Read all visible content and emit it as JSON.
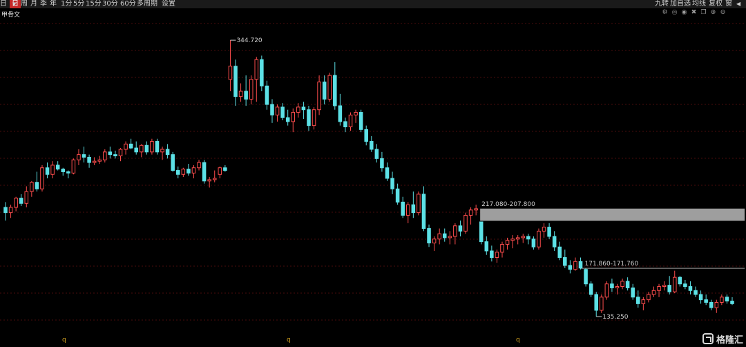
{
  "toolbar": {
    "left": [
      {
        "label": "日"
      },
      {
        "label": "日",
        "active": true
      },
      {
        "label": "周"
      },
      {
        "label": "月"
      },
      {
        "label": "季"
      },
      {
        "label": "年"
      },
      {
        "label": "1分"
      },
      {
        "label": "5分"
      },
      {
        "label": "15分"
      },
      {
        "label": "30分"
      },
      {
        "label": "60分"
      },
      {
        "label": "多周期"
      },
      {
        "label": "设置"
      }
    ],
    "right": [
      {
        "label": "九转"
      },
      {
        "label": "加自选"
      },
      {
        "label": "均线"
      },
      {
        "label": "复权"
      },
      {
        "label": "窗"
      }
    ]
  },
  "stock": {
    "name": "甲骨文"
  },
  "subbar_icons": [
    "settings-icon",
    "crosshair-icon",
    "eye-icon",
    "delete-icon",
    "copy-icon",
    "zoom-in-icon",
    "zoom-out-icon"
  ],
  "annotations": {
    "high": "344.720",
    "low": "135.250",
    "gap1": "217.080-207.800",
    "gap2": "171.860-171.760"
  },
  "x_axis_labels": [
    "q",
    "q",
    "q"
  ],
  "watermark": "格隆汇",
  "colors": {
    "up": "#ff4d4d",
    "down": "#5ce1e6",
    "grid": "#4a0d0d",
    "gap_box": "#9e9e9e",
    "background": "#000000"
  },
  "chart_data": {
    "type": "candlestick",
    "title": "",
    "note": "Each candle: [open, high, low, close]",
    "ohlc": [
      [
        218,
        222,
        208,
        214
      ],
      [
        214,
        220,
        210,
        218
      ],
      [
        218,
        226,
        215,
        225
      ],
      [
        225,
        228,
        219,
        221
      ],
      [
        221,
        234,
        218,
        230
      ],
      [
        230,
        238,
        226,
        237
      ],
      [
        237,
        245,
        230,
        232
      ],
      [
        232,
        250,
        230,
        248
      ],
      [
        248,
        252,
        240,
        243
      ],
      [
        243,
        253,
        240,
        250
      ],
      [
        250,
        253,
        246,
        247
      ],
      [
        247,
        248,
        242,
        245
      ],
      [
        245,
        246,
        240,
        244
      ],
      [
        244,
        255,
        243,
        254
      ],
      [
        254,
        262,
        250,
        258
      ],
      [
        258,
        264,
        252,
        256
      ],
      [
        256,
        258,
        248,
        252
      ],
      [
        252,
        256,
        250,
        253
      ],
      [
        253,
        257,
        251,
        254
      ],
      [
        254,
        262,
        252,
        260
      ],
      [
        260,
        264,
        255,
        258
      ],
      [
        258,
        261,
        255,
        257
      ],
      [
        257,
        263,
        253,
        262
      ],
      [
        262,
        268,
        258,
        266
      ],
      [
        266,
        270,
        262,
        263
      ],
      [
        263,
        268,
        258,
        260
      ],
      [
        260,
        266,
        256,
        265
      ],
      [
        265,
        268,
        258,
        260
      ],
      [
        260,
        270,
        258,
        268
      ],
      [
        268,
        270,
        258,
        260
      ],
      [
        260,
        264,
        254,
        262
      ],
      [
        262,
        266,
        255,
        258
      ],
      [
        258,
        260,
        245,
        246
      ],
      [
        246,
        249,
        240,
        243
      ],
      [
        243,
        248,
        241,
        247
      ],
      [
        247,
        251,
        242,
        244
      ],
      [
        244,
        250,
        240,
        248
      ],
      [
        248,
        254,
        246,
        252
      ],
      [
        252,
        254,
        236,
        238
      ],
      [
        238,
        241,
        233,
        239
      ],
      [
        239,
        246,
        237,
        240
      ],
      [
        243,
        249,
        240,
        248
      ],
      [
        248,
        250,
        245,
        246
      ],
      [
        315,
        344.7,
        306,
        325
      ],
      [
        325,
        330,
        295,
        302
      ],
      [
        302,
        312,
        298,
        306
      ],
      [
        306,
        318,
        295,
        300
      ],
      [
        300,
        318,
        296,
        315
      ],
      [
        315,
        332,
        298,
        330
      ],
      [
        330,
        333,
        306,
        310
      ],
      [
        310,
        314,
        292,
        296
      ],
      [
        296,
        300,
        282,
        288
      ],
      [
        288,
        296,
        283,
        294
      ],
      [
        294,
        297,
        284,
        286
      ],
      [
        286,
        292,
        280,
        283
      ],
      [
        283,
        293,
        275,
        290
      ],
      [
        290,
        297,
        286,
        294
      ],
      [
        294,
        298,
        285,
        292
      ],
      [
        292,
        295,
        276,
        280
      ],
      [
        280,
        294,
        277,
        292
      ],
      [
        292,
        318,
        288,
        313
      ],
      [
        313,
        318,
        296,
        300
      ],
      [
        300,
        320,
        298,
        318
      ],
      [
        318,
        328,
        292,
        295
      ],
      [
        295,
        304,
        280,
        283
      ],
      [
        283,
        286,
        275,
        279
      ],
      [
        279,
        290,
        276,
        288
      ],
      [
        288,
        292,
        282,
        290
      ],
      [
        290,
        292,
        275,
        277
      ],
      [
        277,
        280,
        265,
        268
      ],
      [
        268,
        272,
        260,
        262
      ],
      [
        262,
        266,
        252,
        255
      ],
      [
        255,
        260,
        245,
        248
      ],
      [
        248,
        252,
        238,
        240
      ],
      [
        240,
        245,
        228,
        232
      ],
      [
        232,
        236,
        220,
        222
      ],
      [
        222,
        226,
        210,
        212
      ],
      [
        212,
        222,
        206,
        220
      ],
      [
        220,
        230,
        210,
        214
      ],
      [
        214,
        230,
        212,
        228
      ],
      [
        228,
        234,
        200,
        202
      ],
      [
        202,
        205,
        188,
        191
      ],
      [
        191,
        196,
        185,
        194
      ],
      [
        194,
        202,
        190,
        198
      ],
      [
        198,
        202,
        192,
        195
      ],
      [
        195,
        200,
        190,
        196
      ],
      [
        196,
        206,
        190,
        204
      ],
      [
        204,
        208,
        196,
        200
      ],
      [
        200,
        214,
        198,
        212
      ],
      [
        212,
        218,
        205,
        216
      ],
      [
        216,
        220,
        212,
        217
      ],
      [
        207,
        207,
        190,
        192
      ],
      [
        192,
        196,
        182,
        185
      ],
      [
        185,
        189,
        177,
        180
      ],
      [
        180,
        186,
        176,
        184
      ],
      [
        184,
        192,
        180,
        190
      ],
      [
        190,
        195,
        186,
        193
      ],
      [
        193,
        197,
        187,
        194
      ],
      [
        194,
        197,
        190,
        195
      ],
      [
        195,
        198,
        191,
        196
      ],
      [
        196,
        198,
        190,
        194
      ],
      [
        194,
        196,
        186,
        188
      ],
      [
        188,
        202,
        186,
        200
      ],
      [
        200,
        206,
        195,
        203
      ],
      [
        203,
        206,
        194,
        196
      ],
      [
        196,
        200,
        185,
        188
      ],
      [
        188,
        192,
        178,
        180
      ],
      [
        180,
        186,
        172,
        174
      ],
      [
        174,
        178,
        168,
        171
      ],
      [
        171,
        180,
        170,
        177
      ],
      [
        177,
        180,
        171,
        172
      ],
      [
        171,
        172,
        158,
        160
      ],
      [
        160,
        162,
        150,
        152
      ],
      [
        152,
        154,
        135.25,
        140
      ],
      [
        140,
        152,
        138,
        150
      ],
      [
        150,
        162,
        148,
        160
      ],
      [
        160,
        164,
        154,
        157
      ],
      [
        157,
        160,
        152,
        158
      ],
      [
        158,
        164,
        156,
        162
      ],
      [
        162,
        165,
        155,
        157
      ],
      [
        157,
        160,
        148,
        150
      ],
      [
        150,
        155,
        142,
        145
      ],
      [
        145,
        150,
        140,
        148
      ],
      [
        148,
        154,
        146,
        152
      ],
      [
        152,
        158,
        150,
        155
      ],
      [
        155,
        160,
        150,
        158
      ],
      [
        158,
        162,
        155,
        159
      ],
      [
        159,
        166,
        152,
        154
      ],
      [
        154,
        170,
        153,
        165
      ],
      [
        165,
        166,
        158,
        160
      ],
      [
        160,
        163,
        156,
        158
      ],
      [
        158,
        162,
        152,
        155
      ],
      [
        155,
        158,
        150,
        152
      ],
      [
        152,
        155,
        145,
        148
      ],
      [
        148,
        152,
        144,
        146
      ],
      [
        146,
        148,
        140,
        142
      ],
      [
        142,
        148,
        138,
        146
      ],
      [
        146,
        152,
        144,
        150
      ],
      [
        150,
        152,
        145,
        147
      ],
      [
        147,
        150,
        144,
        145
      ]
    ]
  }
}
